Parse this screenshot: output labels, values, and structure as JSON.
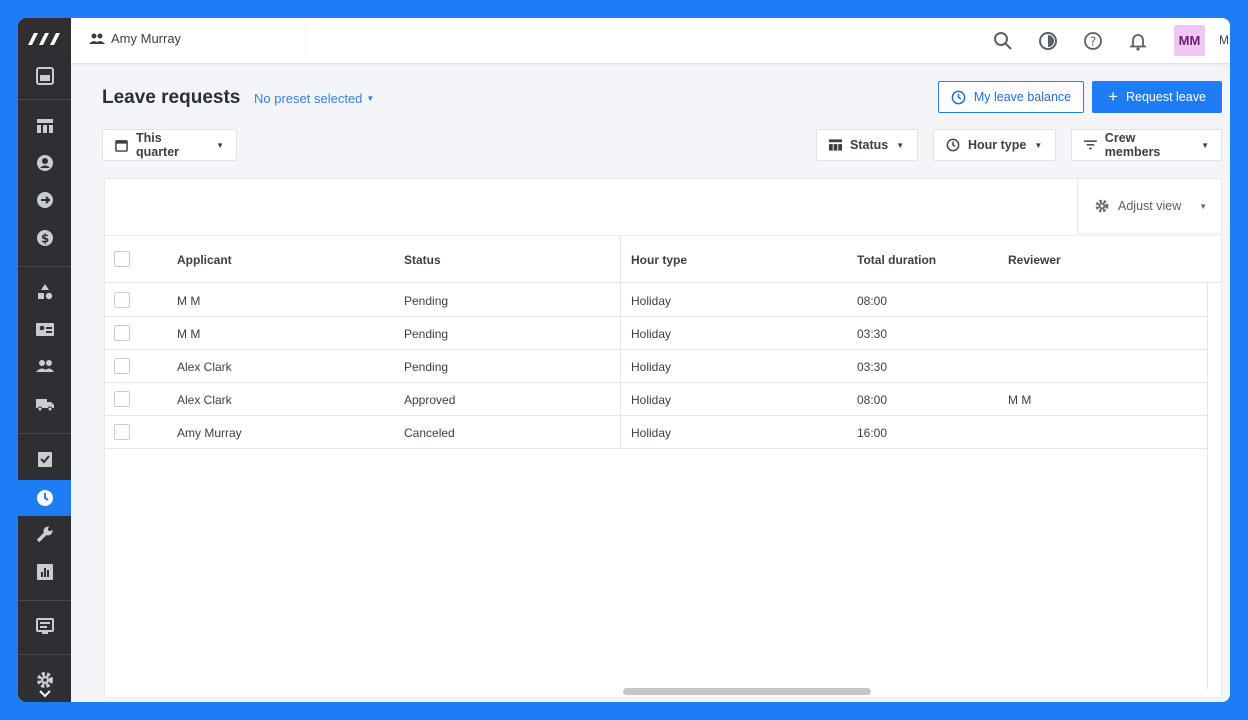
{
  "topbar": {
    "user_context": "Amy Murray",
    "avatar_initials": "MM",
    "avatar_name": "M"
  },
  "header": {
    "title": "Leave requests",
    "preset": "No preset selected",
    "balance_button": "My leave balance",
    "request_button": "Request leave"
  },
  "filters": {
    "period": "This quarter",
    "status": "Status",
    "hour_type": "Hour type",
    "crew_members": "Crew members"
  },
  "table": {
    "adjust_view": "Adjust view",
    "columns": [
      "Applicant",
      "Status",
      "Hour type",
      "Total duration",
      "Reviewer"
    ],
    "rows": [
      {
        "applicant": "M M",
        "status": "Pending",
        "hour_type": "Holiday",
        "duration": "08:00",
        "reviewer": ""
      },
      {
        "applicant": "M M",
        "status": "Pending",
        "hour_type": "Holiday",
        "duration": "03:30",
        "reviewer": ""
      },
      {
        "applicant": "Alex Clark",
        "status": "Pending",
        "hour_type": "Holiday",
        "duration": "03:30",
        "reviewer": ""
      },
      {
        "applicant": "Alex Clark",
        "status": "Approved",
        "hour_type": "Holiday",
        "duration": "08:00",
        "reviewer": "M M"
      },
      {
        "applicant": "Amy Murray",
        "status": "Canceled",
        "hour_type": "Holiday",
        "duration": "16:00",
        "reviewer": ""
      }
    ]
  },
  "colors": {
    "accent": "#1e7cf5",
    "sidebar": "#2d2f33",
    "avatar_bg": "#f0c6f2"
  }
}
